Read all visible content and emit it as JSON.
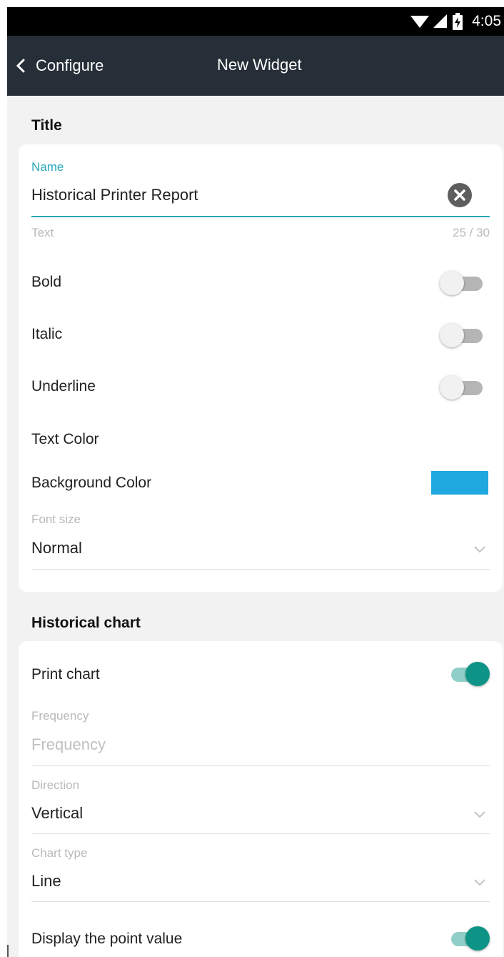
{
  "status_bar": {
    "time": "4:05",
    "icons": [
      "wifi-icon",
      "signal-icon",
      "battery-charging-icon"
    ]
  },
  "app_bar": {
    "back_label": "Configure",
    "title": "New Widget"
  },
  "title_section": {
    "heading": "Title",
    "name_label": "Name",
    "name_value": "Historical Printer Report",
    "helper_text": "Text",
    "char_counter": "25 / 30",
    "bold_label": "Bold",
    "bold_on": false,
    "italic_label": "Italic",
    "italic_on": false,
    "underline_label": "Underline",
    "underline_on": false,
    "text_color_label": "Text Color",
    "background_color_label": "Background Color",
    "background_color": "#1fa8e0",
    "font_size_label": "Font size",
    "font_size_value": "Normal"
  },
  "chart_section": {
    "heading": "Historical chart",
    "print_chart_label": "Print chart",
    "print_chart_on": true,
    "frequency_label": "Frequency",
    "frequency_placeholder": "Frequency",
    "direction_label": "Direction",
    "direction_value": "Vertical",
    "chart_type_label": "Chart type",
    "chart_type_value": "Line",
    "display_point_value_label": "Display the point value",
    "display_point_value_on": true
  },
  "colors": {
    "accent": "#27a8b9",
    "toggle_on": "#0e9486",
    "app_bar": "#262f38"
  }
}
